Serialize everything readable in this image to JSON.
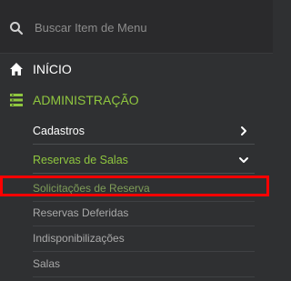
{
  "search": {
    "placeholder": "Buscar Item de Menu",
    "icon": "search-icon"
  },
  "menu": {
    "inicio": {
      "label": "INÍCIO",
      "icon": "home-icon"
    },
    "administracao": {
      "label": "ADMINISTRAÇÃO",
      "icon": "admin-list-icon"
    },
    "submenu": {
      "cadastros": {
        "label": "Cadastros",
        "icon": "chevron-right-icon"
      },
      "reservas_de_salas": {
        "label": "Reservas de Salas",
        "icon": "chevron-down-icon"
      },
      "items": [
        {
          "label": "Solicitações de Reserva",
          "highlighted": true
        },
        {
          "label": "Reservas Deferidas"
        },
        {
          "label": "Indisponibilizações"
        },
        {
          "label": "Salas"
        }
      ]
    }
  },
  "colors": {
    "background": "#2f3032",
    "accent_green": "#8fc63f",
    "highlight_red": "#ff0000"
  }
}
